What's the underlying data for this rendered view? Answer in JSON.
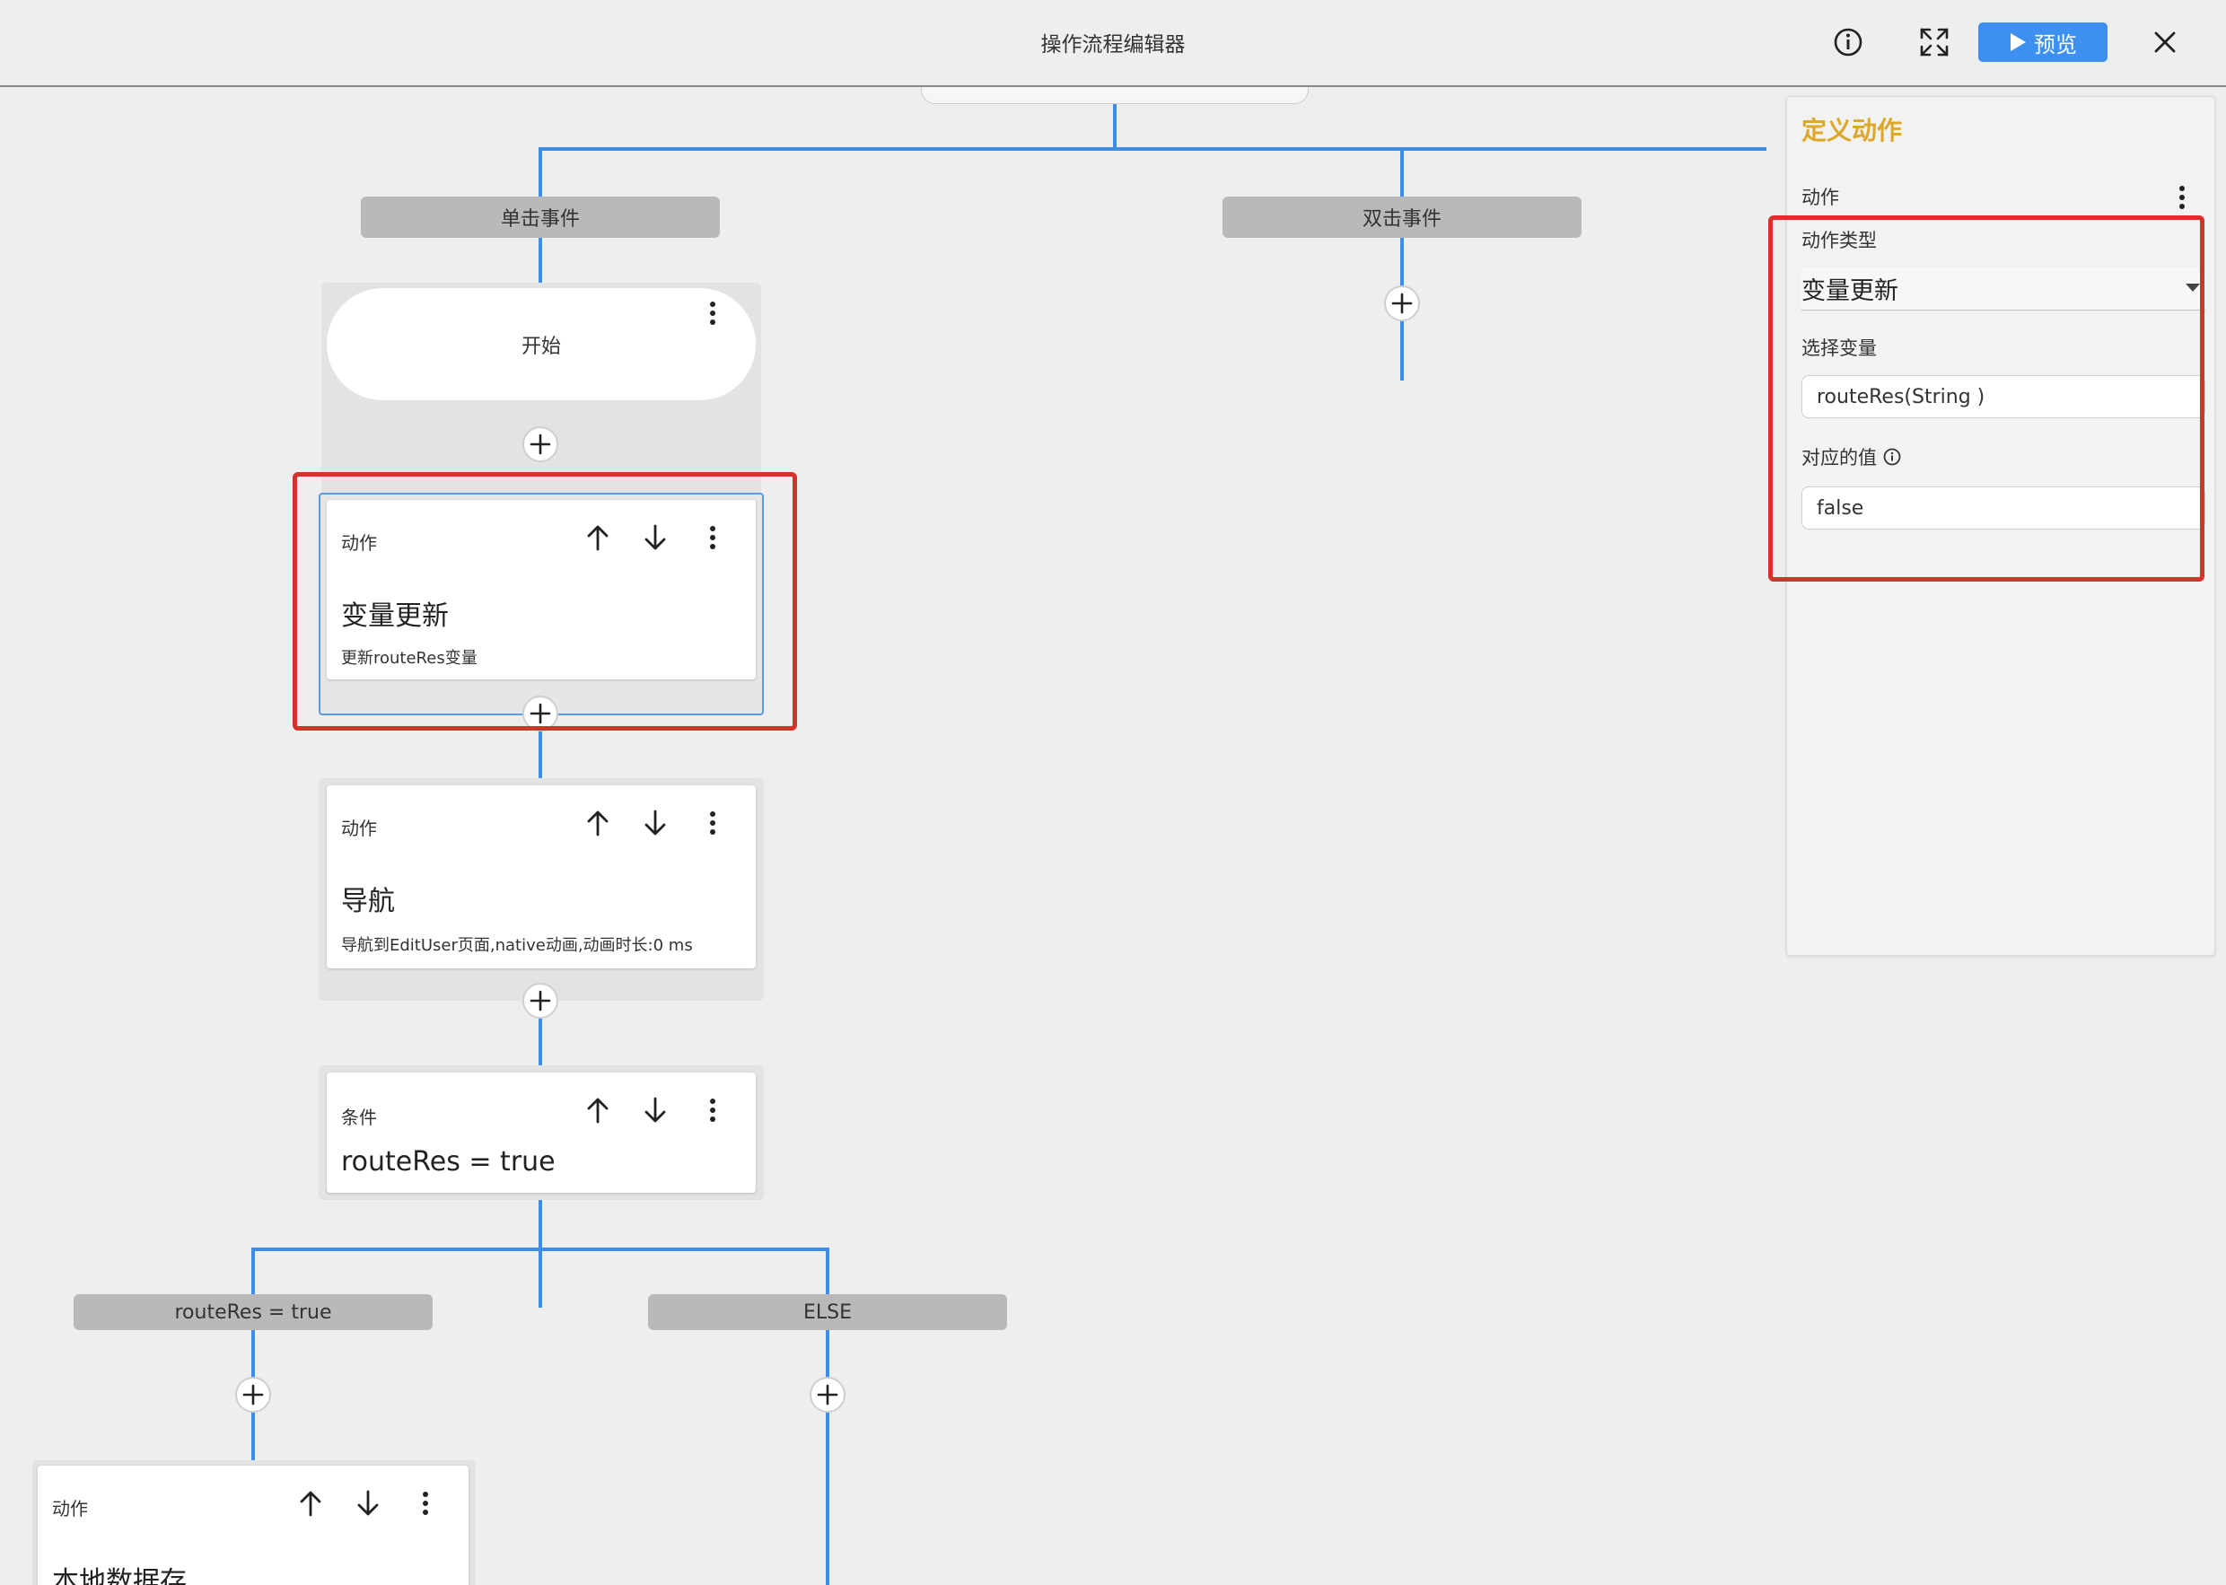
{
  "header": {
    "title": "操作流程编辑器",
    "preview_label": "预览",
    "icons": [
      "info-icon",
      "fullscreen-icon",
      "play-icon",
      "close-icon"
    ]
  },
  "events": [
    {
      "label": "单击事件"
    },
    {
      "label": "双击事件"
    }
  ],
  "flow": {
    "start_label": "开始",
    "nodes": [
      {
        "kind": "动作",
        "title": "变量更新",
        "desc": "更新routeRes变量"
      },
      {
        "kind": "动作",
        "title": "导航",
        "desc": "导航到EditUser页面,native动画,动画时长:0 ms"
      },
      {
        "kind": "条件",
        "title": "routeRes = true"
      }
    ],
    "branches": [
      {
        "label": "routeRes = true"
      },
      {
        "label": "ELSE"
      }
    ],
    "bottom_node": {
      "kind": "动作",
      "title": "本地数据存"
    }
  },
  "panel": {
    "title": "定义动作",
    "section_label": "动作",
    "action_type_label": "动作类型",
    "action_type_value": "变量更新",
    "select_var_label": "选择变量",
    "select_var_value": "routeRes(String )",
    "value_label": "对应的值",
    "value_value": "false"
  },
  "colors": {
    "accent": "#3d8ff0",
    "connector": "#3e8ee8",
    "panel_title": "#dda82a",
    "highlight": "#d9302a"
  }
}
